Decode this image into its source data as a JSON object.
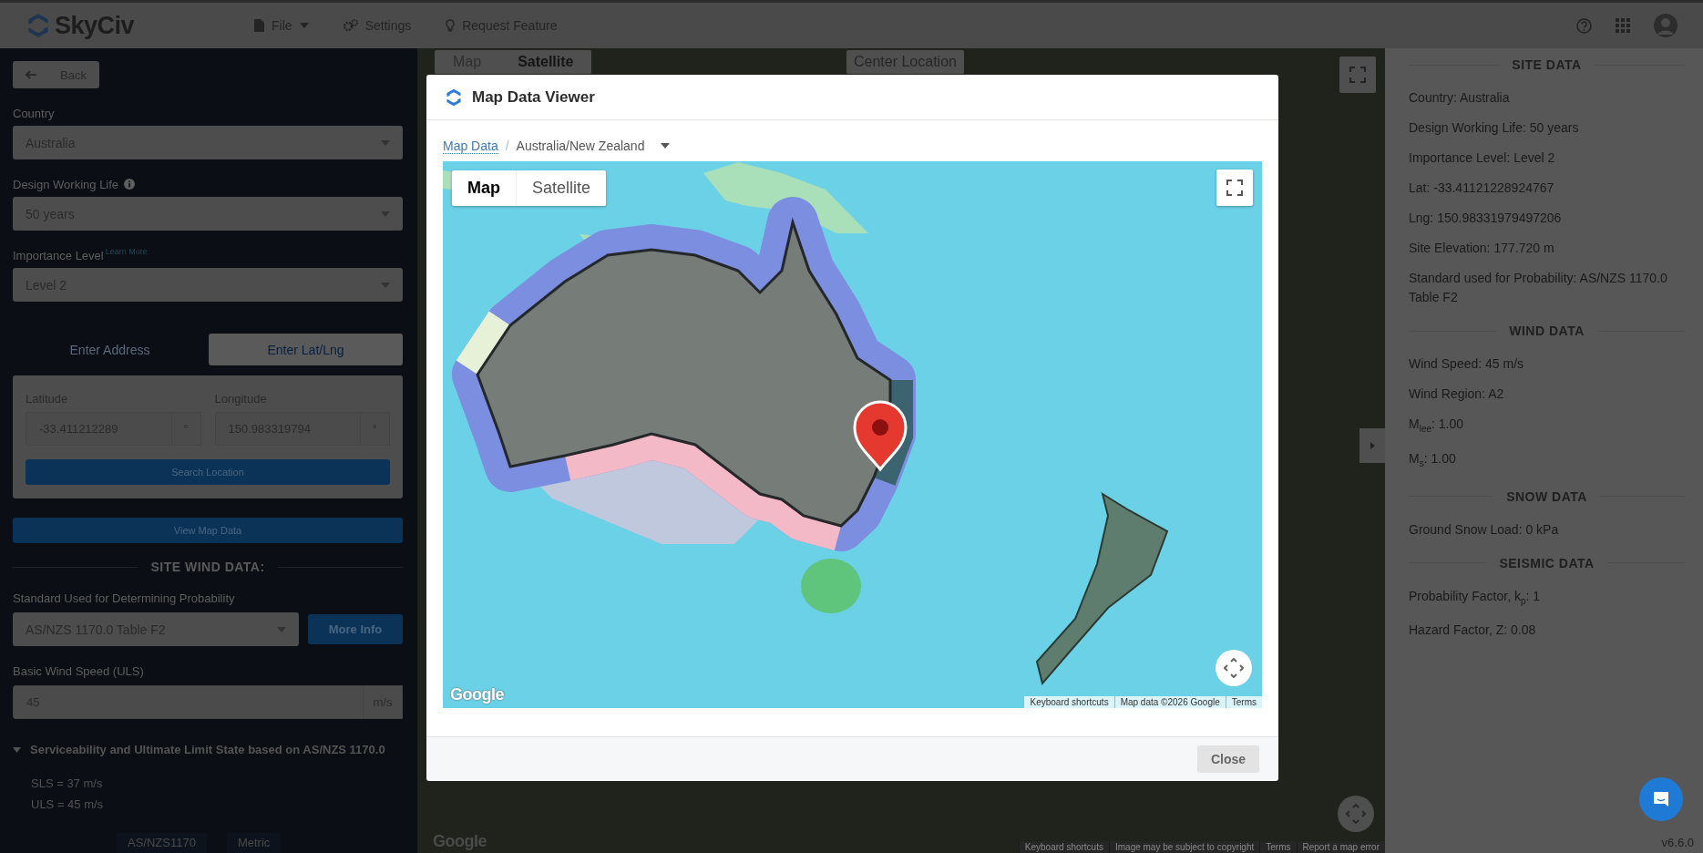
{
  "top_bar": {
    "logo": "SkyCiv",
    "menu": [
      {
        "label": "File",
        "kind": "file"
      },
      {
        "label": "Settings",
        "kind": "settings"
      },
      {
        "label": "Request Feature",
        "kind": "feature"
      }
    ]
  },
  "left_panel": {
    "back_button": "Back",
    "fields": [
      {
        "label": "Country",
        "value": "Australia",
        "hint_icon": false
      },
      {
        "label": "Design Working Life",
        "value": "50 years",
        "hint_icon": true
      },
      {
        "label": "Importance Level",
        "value": "Level 2",
        "hint_icon": false,
        "link": "Learn More"
      }
    ],
    "location_tabs": [
      {
        "label": "Enter Address",
        "selected": false
      },
      {
        "label": "Enter Lat/Lng",
        "selected": true
      }
    ],
    "coordinates": [
      {
        "label": "Latitude",
        "value": "-33.411212289",
        "unit": "°"
      },
      {
        "label": "Longitude",
        "value": "150.983319794",
        "unit": "°"
      }
    ],
    "search_button": "Search Location",
    "view_map_button": "View Map Data",
    "wind_section": {
      "title": "SITE WIND DATA:",
      "standard": {
        "label": "Standard Used for Determining Probability",
        "value": "AS/NZS 1170.0 Table F2"
      },
      "more_info_button": "More Info",
      "wind_speed": {
        "label": "Basic Wind Speed (ULS)",
        "value": "45",
        "unit": "m/s"
      },
      "limit_state": {
        "title": "Serviceability and Ultimate Limit State based on AS/NZS 1170.0",
        "expanded": true,
        "lines": [
          "SLS = 37 m/s",
          "ULS = 45 m/s"
        ]
      }
    },
    "footer": [
      "AS/NZS1170",
      "Metric"
    ]
  },
  "background_map": {
    "map_types": [
      {
        "label": "Map",
        "selected": false
      },
      {
        "label": "Satellite",
        "selected": true
      }
    ],
    "center_button": "Center Location",
    "logo": "Google",
    "attribution": [
      "Keyboard shortcuts",
      "Image may be subject to copyright",
      "Terms",
      "Report a map error"
    ]
  },
  "right_panel": {
    "sections": [
      {
        "title": "SITE DATA",
        "items": [
          "Country: Australia",
          "Design Working Life: 50 years",
          "Importance Level: Level 2",
          "Lat: -33.41121228924767",
          "Lng: 150.98331979497206",
          "Site Elevation: 177.720 m",
          "Standard used for Probability: AS/NZS 1170.0 Table F2"
        ]
      },
      {
        "title": "WIND DATA",
        "items": [
          "Wind Speed: 45 m/s",
          "Wind Region: A2",
          "M$_{lee}$: 1.00",
          "M$_{s}$: 1.00"
        ]
      },
      {
        "title": "SNOW DATA",
        "items": [
          "Ground Snow Load: 0 kPa"
        ]
      },
      {
        "title": "SEISMIC DATA",
        "items": [
          "Probability Factor, k$_{p}$: 1",
          "Hazard Factor, Z: 0.08"
        ]
      }
    ],
    "version": "v6.6.0"
  },
  "modal": {
    "title": "Map Data Viewer",
    "breadcrumb": {
      "link": "Map Data",
      "separator": "/",
      "current": "Australia/New Zealand"
    },
    "map": {
      "map_types": [
        {
          "label": "Map",
          "selected": true
        },
        {
          "label": "Satellite",
          "selected": false
        }
      ],
      "logo": "Google",
      "attribution": [
        "Keyboard shortcuts",
        "Map data ©2026 Google",
        "Terms"
      ]
    },
    "close_button": "Close"
  }
}
